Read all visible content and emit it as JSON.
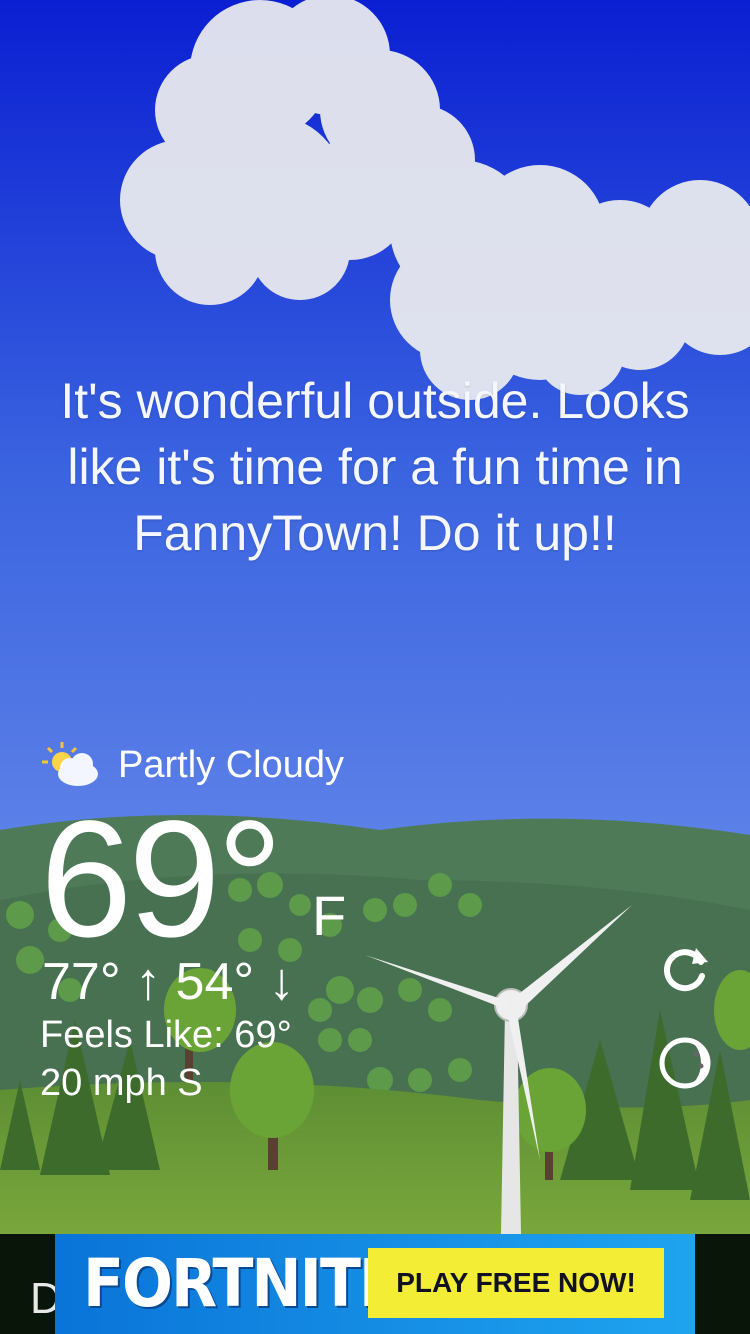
{
  "weather": {
    "message": "It's wonderful outside. Looks like it's time for a fun time in FannyTown! Do it up!!",
    "condition": "Partly Cloudy",
    "condition_icon": "partly-cloudy-icon",
    "temperature": "69°",
    "unit": "F",
    "high_low": "77° ↑  54° ↓",
    "feels_like": "Feels Like: 69°",
    "wind": "20 mph S"
  },
  "controls": {
    "refresh_icon": "refresh-icon",
    "moon_icon": "moon-icon"
  },
  "ad": {
    "brand": "FORTNITE",
    "cta": "PLAY FREE NOW!",
    "partial_text": "D"
  },
  "colors": {
    "sky_top": "#0a1fd2",
    "sky_bottom": "#7a9df0",
    "hills": "#4e7a58",
    "grass": "#6b9a38",
    "ad_cta": "#f3ed35"
  }
}
